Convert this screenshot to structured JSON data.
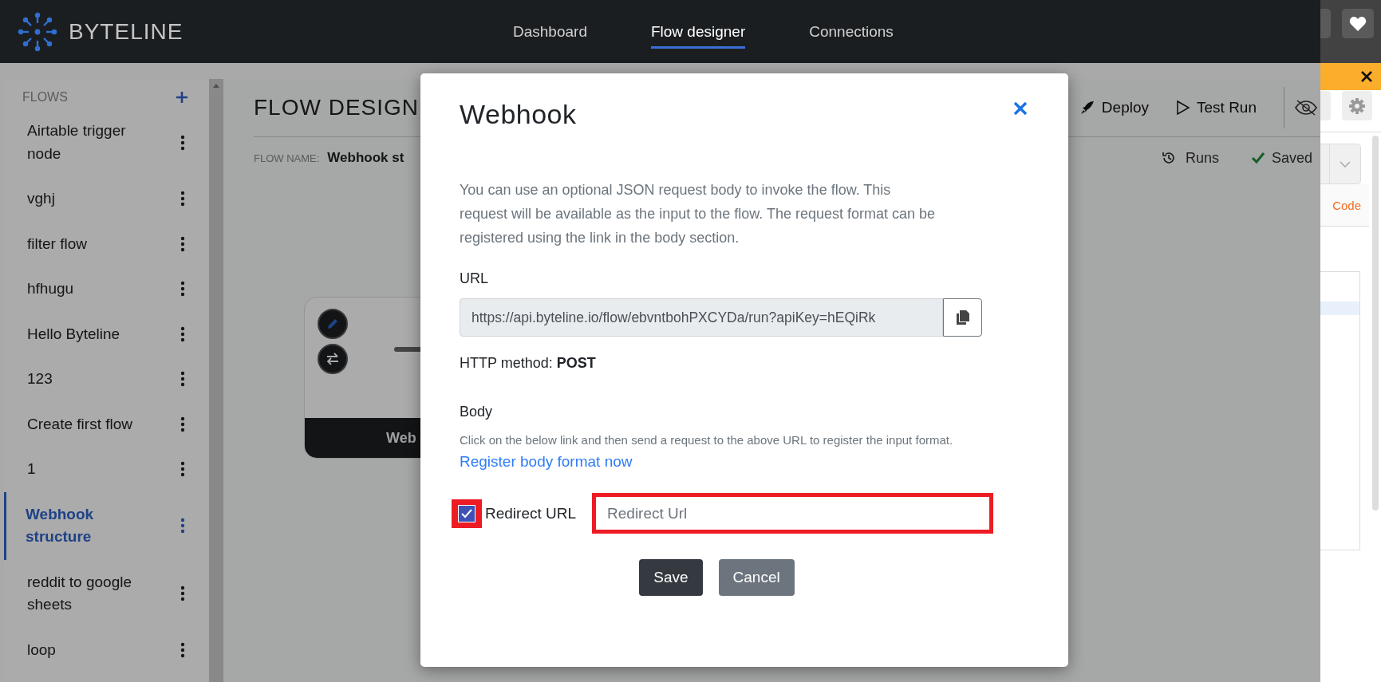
{
  "top_nav": {
    "logo": "BYTELINE",
    "tabs": [
      {
        "label": "Dashboard",
        "selected": false
      },
      {
        "label": "Flow designer",
        "selected": true
      },
      {
        "label": "Connections",
        "selected": false
      }
    ]
  },
  "sidebar": {
    "title": "FLOWS",
    "items": [
      {
        "label": "Airtable trigger node",
        "selected": false
      },
      {
        "label": "vghj",
        "selected": false
      },
      {
        "label": "filter flow",
        "selected": false
      },
      {
        "label": "hfhugu",
        "selected": false
      },
      {
        "label": "Hello Byteline",
        "selected": false
      },
      {
        "label": "123",
        "selected": false
      },
      {
        "label": "Create first flow",
        "selected": false
      },
      {
        "label": "1",
        "selected": false
      },
      {
        "label": "Webhook structure",
        "selected": true
      },
      {
        "label": "reddit to google sheets",
        "selected": false
      },
      {
        "label": "loop",
        "selected": false
      }
    ]
  },
  "main": {
    "title": "FLOW DESIGN",
    "actions": [
      {
        "kind": "deploy",
        "label": "Deploy"
      },
      {
        "kind": "test-run",
        "label": "Test Run"
      }
    ],
    "flow_name_label": "FLOW NAME:",
    "flow_name": "Webhook st",
    "runs": "Runs",
    "status": "Saved",
    "node": {
      "label": "Web"
    }
  },
  "modal": {
    "title": "Webhook",
    "description": "You can use an optional JSON request body to invoke the flow. This request will be available as the input to the flow. The request format can be registered using the link in the body section.",
    "url_label": "URL",
    "url_value": "https://api.byteline.io/flow/ebvntbohPXCYDa/run?apiKey=hEQiRk",
    "method": "HTTP method: **POST**",
    "body_label": "Body",
    "body_hint": "Click on the below link and then send a request to the above URL to register the input format.",
    "link": "Register body format now",
    "redirect": {
      "checked": true,
      "highlighted": true,
      "label": "Redirect URL",
      "placeholder": "Redirect Url"
    },
    "buttons": [
      {
        "kind": "primary",
        "label": "Save"
      },
      {
        "kind": "secondary",
        "label": "Cancel"
      }
    ]
  },
  "extension_panel": {
    "tab": "Code"
  }
}
